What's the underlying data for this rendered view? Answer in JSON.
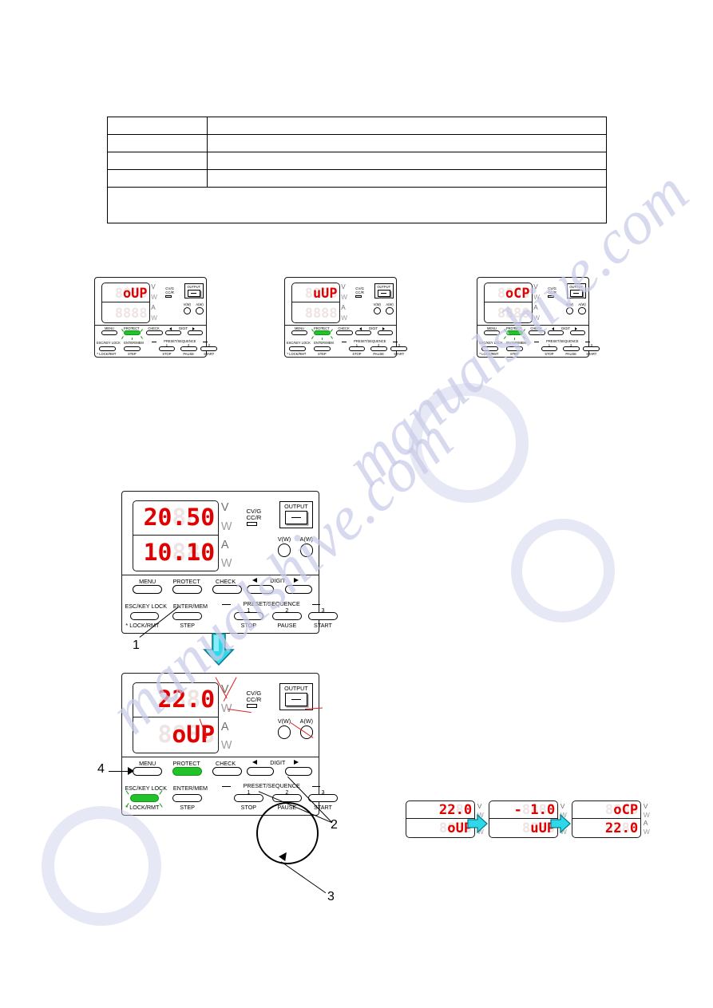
{
  "document": {
    "watermark_text": "manualshive.com"
  },
  "table": {
    "rows": [
      {
        "col1": "",
        "col2": ""
      },
      {
        "col1": "",
        "col2": ""
      },
      {
        "col1": "",
        "col2": ""
      },
      {
        "col1": "",
        "col2": ""
      }
    ],
    "note_row": ""
  },
  "panel_common": {
    "unit_v": "V",
    "unit_w_top": "W",
    "unit_a": "A",
    "unit_w_bot": "W",
    "cv_label": "CV/G",
    "cc_label": "CC/R",
    "output_label": "OUTPUT",
    "knob_v_label": "V(W)",
    "knob_a_label": "A(W)",
    "buttons": {
      "menu": "MENU",
      "protect": "PROTECT",
      "check": "CHECK",
      "digit": "DIGIT",
      "digit_left_icon": "triangle-left-icon",
      "digit_right_icon": "triangle-right-icon",
      "esc_key_lock": "ESC/KEY LOCK",
      "enter_mem": "ENTER/MEM",
      "lock_rmt": "LOCK/RMT",
      "lock_rmt_prefix": "*",
      "step": "STEP",
      "stop": "STOP",
      "pause": "PAUSE",
      "start": "START",
      "preset_sequence": "PRESET/SEQUENCE",
      "preset_1": "1",
      "preset_2": "2",
      "preset_3": "3"
    }
  },
  "row1_panels": [
    {
      "id": "panel-oup",
      "display_top": {
        "ghost": "8888",
        "lit": "oUP"
      },
      "display_bottom": {
        "ghost": "8888",
        "lit": ""
      },
      "protect_led": "on",
      "protect_blinking": true,
      "lock_led": "off"
    },
    {
      "id": "panel-uup",
      "display_top": {
        "ghost": "8888",
        "lit": "uUP"
      },
      "display_bottom": {
        "ghost": "8888",
        "lit": ""
      },
      "protect_led": "on",
      "protect_blinking": true,
      "lock_led": "off"
    },
    {
      "id": "panel-ocp",
      "display_top": {
        "ghost": "8888",
        "lit": "oCP"
      },
      "display_bottom": {
        "ghost": "8888",
        "lit": ""
      },
      "protect_led": "on",
      "protect_blinking": true,
      "lock_led": "off"
    }
  ],
  "big_panel_a": {
    "id": "panel-step1",
    "display_top": {
      "ghost": "8888",
      "lit": "20.50"
    },
    "display_bottom": {
      "ghost": "8888",
      "lit": "10.10"
    },
    "protect_led": "off",
    "lock_led": "off",
    "callout": "1"
  },
  "big_panel_b": {
    "id": "panel-step4",
    "display_top": {
      "ghost": "8888",
      "lit": "22.0"
    },
    "display_bottom": {
      "ghost": "8888",
      "lit": "oUP"
    },
    "protect_led": "on",
    "lock_led": "on",
    "callout_digit": "2",
    "callout_lock": "4"
  },
  "knob_callout": {
    "number": "3"
  },
  "sequence_panels": [
    {
      "id": "seq-1",
      "display_top": {
        "ghost": "8888",
        "lit": "22.0"
      },
      "display_bottom": {
        "ghost": "8888",
        "lit": "oUP"
      }
    },
    {
      "id": "seq-2",
      "display_top": {
        "ghost": "8888",
        "lit": "- 1.0"
      },
      "display_bottom": {
        "ghost": "8888",
        "lit": "uUP"
      }
    },
    {
      "id": "seq-3",
      "display_top": {
        "ghost": "8888",
        "lit": "oCP"
      },
      "display_bottom": {
        "ghost": "8888",
        "lit": "22.0"
      }
    }
  ],
  "colors": {
    "led_green": "#22c32a",
    "segment_red": "#e00000",
    "segment_ghost": "#efe4e4",
    "arrow_cyan": "#2fd8e8",
    "watermark": "#c9cbe8"
  }
}
